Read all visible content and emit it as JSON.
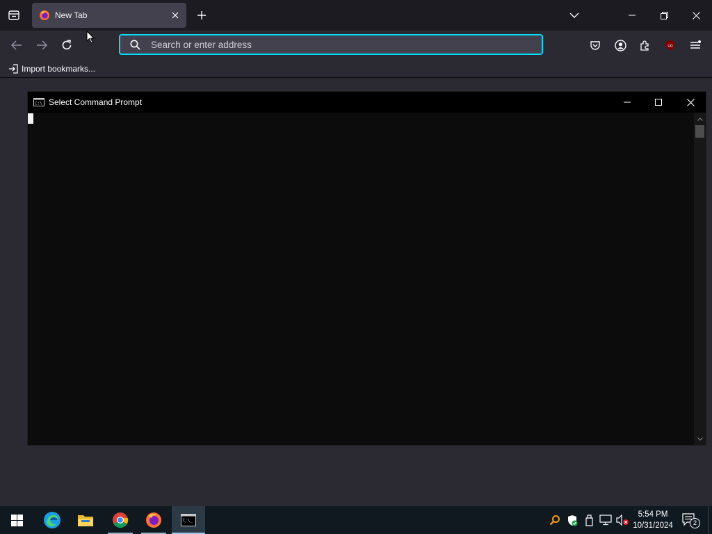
{
  "browser": {
    "tab": {
      "title": "New Tab"
    },
    "url_bar": {
      "placeholder": "Search or enter address",
      "value": ""
    },
    "bookmarks": {
      "import_label": "Import bookmarks..."
    },
    "accent_color": "#00ddff"
  },
  "cmd_window": {
    "title": "Select Command Prompt"
  },
  "taskbar": {
    "apps": [
      "windows-start",
      "edge",
      "file-explorer",
      "chrome",
      "firefox",
      "command-prompt"
    ],
    "active_app": "command-prompt",
    "clock": {
      "time": "5:54 PM",
      "date": "10/31/2024"
    },
    "notification_count": "2"
  }
}
